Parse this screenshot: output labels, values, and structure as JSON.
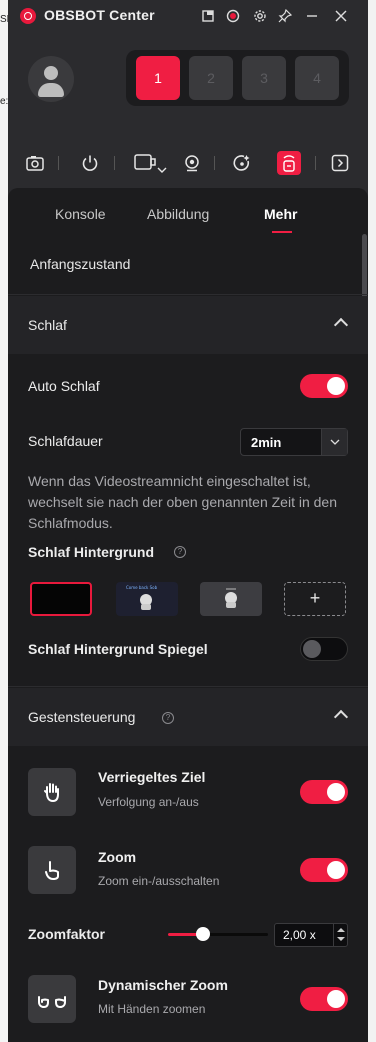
{
  "background_window": {
    "fragments": [
      "SE",
      "e:"
    ]
  },
  "titlebar": {
    "title": "OBSBOT Center"
  },
  "header": {
    "device_slots": [
      "1",
      "2",
      "3",
      "4"
    ],
    "active_slot": 0
  },
  "toolbar": {
    "icons": [
      "camera-icon",
      "power-icon",
      "record-icon",
      "webcam-icon",
      "tracking-icon",
      "remote-icon",
      "panel-toggle-icon"
    ]
  },
  "tabs": [
    {
      "label": "Konsole"
    },
    {
      "label": "Abbildung"
    },
    {
      "label": "Mehr",
      "active": true
    }
  ],
  "initial_state": {
    "label": "Anfangszustand"
  },
  "sleep_section": {
    "title": "Schlaf",
    "expanded": true,
    "auto_sleep": {
      "label": "Auto Schlaf",
      "on": true
    },
    "sleep_duration": {
      "label": "Schlafdauer",
      "value": "2min"
    },
    "description": "Wenn das Videostreamnicht eingeschaltet ist, wechselt sie nach der oben genannten Zeit in den Schlafmodus.",
    "background": {
      "label": "Schlaf Hintergrund",
      "help": "?",
      "thumb_text": "Come back Sob"
    },
    "background_mirror": {
      "label": "Schlaf Hintergrund Spiegel",
      "on": false
    }
  },
  "gesture_section": {
    "title": "Gestensteuerung",
    "help": "?",
    "expanded": true,
    "items": [
      {
        "title": "Verriegeltes Ziel",
        "subtitle": "Verfolgung an-/aus",
        "icon": "hand-open-icon",
        "on": true
      },
      {
        "title": "Zoom",
        "subtitle": "Zoom ein-/ausschalten",
        "icon": "hand-point-icon",
        "on": true
      }
    ],
    "zoom_factor": {
      "label": "Zoomfaktor",
      "value": "2,00 x",
      "level": 0.35
    },
    "dynamic_zoom": {
      "title": "Dynamischer Zoom",
      "subtitle": "Mit Händen zoomen",
      "icon": "two-hands-icon",
      "on": true
    }
  },
  "colors": {
    "accent": "#f01e43",
    "panel": "#1c1c1e",
    "window": "#2b2b2e"
  }
}
